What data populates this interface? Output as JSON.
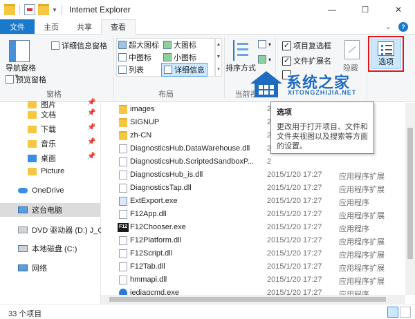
{
  "window": {
    "title": "Internet Explorer",
    "minimize": "—",
    "maximize": "☐",
    "close": "✕"
  },
  "tabs": {
    "file": "文件",
    "home": "主页",
    "share": "共享",
    "view": "查看"
  },
  "ribbon": {
    "pane_group": {
      "nav_pane": "导航窗格",
      "preview_pane": "预览窗格",
      "details_pane": "详细信息窗格",
      "label": "窗格"
    },
    "layout_group": {
      "extra_large": "超大图标",
      "large": "大图标",
      "medium": "中图标",
      "small": "小图标",
      "list": "列表",
      "details": "详细信息",
      "label": "布局"
    },
    "current_view_group": {
      "sort_by": "排序方式",
      "label": "当前视"
    },
    "show_hide_group": {
      "item_checkboxes": "项目复选框",
      "file_extensions": "文件扩展名",
      "hide": "隐藏"
    },
    "options": "选项"
  },
  "nav": {
    "items": [
      {
        "label": "图片"
      },
      {
        "label": "文档"
      },
      {
        "label": "下载"
      },
      {
        "label": "音乐"
      },
      {
        "label": "桌面"
      },
      {
        "label": "Picture"
      },
      {
        "label": "OneDrive"
      },
      {
        "label": "这台电脑"
      },
      {
        "label": "DVD 驱动器 (D:) J_C"
      },
      {
        "label": "本地磁盘 (C:)"
      },
      {
        "label": "网络"
      }
    ]
  },
  "files": [
    {
      "name": "images",
      "date": "2",
      "type": "",
      "icon": "folder"
    },
    {
      "name": "SIGNUP",
      "date": "2",
      "type": "",
      "icon": "folder"
    },
    {
      "name": "zh-CN",
      "date": "2",
      "type": "",
      "icon": "folder"
    },
    {
      "name": "DiagnosticsHub.DataWarehouse.dll",
      "date": "2",
      "type": "",
      "icon": "dll"
    },
    {
      "name": "DiagnosticsHub.ScriptedSandboxP...",
      "date": "2",
      "type": "",
      "icon": "dll"
    },
    {
      "name": "DiagnosticsHub_is.dll",
      "date": "2015/1/20 17:27",
      "type": "应用程序扩展",
      "icon": "dll"
    },
    {
      "name": "DiagnosticsTap.dll",
      "date": "2015/1/20 17:27",
      "type": "应用程序扩展",
      "icon": "dll"
    },
    {
      "name": "ExtExport.exe",
      "date": "2015/1/20 17:27",
      "type": "应用程序",
      "icon": "exe"
    },
    {
      "name": "F12App.dll",
      "date": "2015/1/20 17:27",
      "type": "应用程序扩展",
      "icon": "dll"
    },
    {
      "name": "F12Chooser.exe",
      "date": "2015/1/20 17:27",
      "type": "应用程序",
      "icon": "f12"
    },
    {
      "name": "F12Platform.dll",
      "date": "2015/1/20 17:27",
      "type": "应用程序扩展",
      "icon": "dll"
    },
    {
      "name": "F12Script.dll",
      "date": "2015/1/20 17:27",
      "type": "应用程序扩展",
      "icon": "dll"
    },
    {
      "name": "F12Tab.dll",
      "date": "2015/1/20 17:27",
      "type": "应用程序扩展",
      "icon": "dll"
    },
    {
      "name": "hmmapi.dll",
      "date": "2015/1/20 17:27",
      "type": "应用程序扩展",
      "icon": "dll"
    },
    {
      "name": "iediagcmd.exe",
      "date": "2015/1/20 17:27",
      "type": "应用程序",
      "icon": "ie"
    }
  ],
  "tooltip": {
    "title": "选项",
    "body": "更改用于打开项目、文件和文件夹视图以及搜索等方面的设置。"
  },
  "status": {
    "count": "33 个项目"
  },
  "watermark": {
    "text": "系统之家",
    "sub": "XITONGZHIJIA.NET"
  },
  "colors": {
    "accent": "#1979ca",
    "highlight_border": "#e0161b",
    "selected_button": "#cce8ff"
  }
}
